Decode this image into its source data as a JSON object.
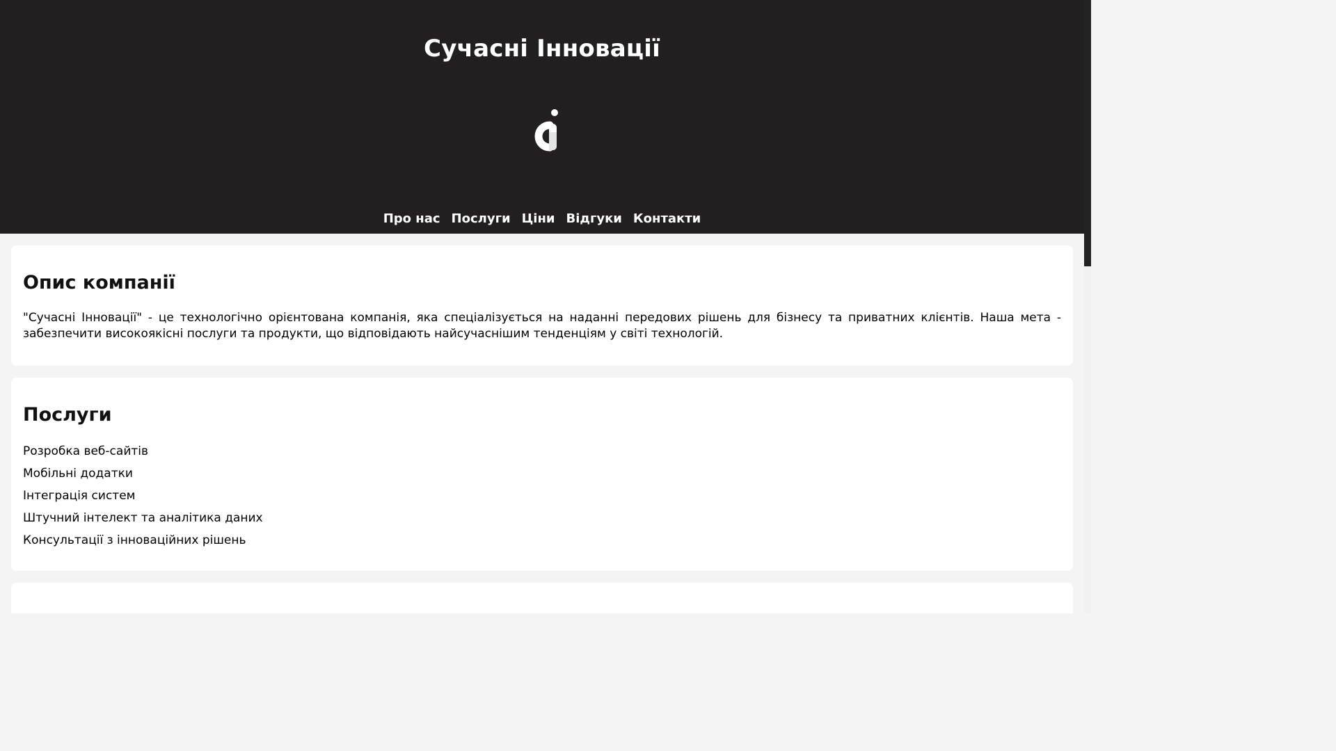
{
  "header": {
    "title": "Сучасні Інновації",
    "logo_icon": "ci-logo-icon",
    "background": "#221f20"
  },
  "nav": {
    "items": [
      {
        "label": "Про нас"
      },
      {
        "label": "Послуги"
      },
      {
        "label": "Ціни"
      },
      {
        "label": "Відгуки"
      },
      {
        "label": "Контакти"
      }
    ]
  },
  "about": {
    "heading": "Опис компанії",
    "text": "\"Сучасні Інновації\" - це технологічно орієнтована компанія, яка спеціалізується на наданні передових рішень для бізнесу та приватних клієнтів. Наша мета - забезпечити високоякісні послуги та продукти, що відповідають найсучаснішим тенденціям у світі технологій."
  },
  "services": {
    "heading": "Послуги",
    "items": [
      "Розробка веб-сайтів",
      "Мобільні додатки",
      "Інтеграція систем",
      "Штучний інтелект та аналітика даних",
      "Консультації з інноваційних рішень"
    ]
  }
}
